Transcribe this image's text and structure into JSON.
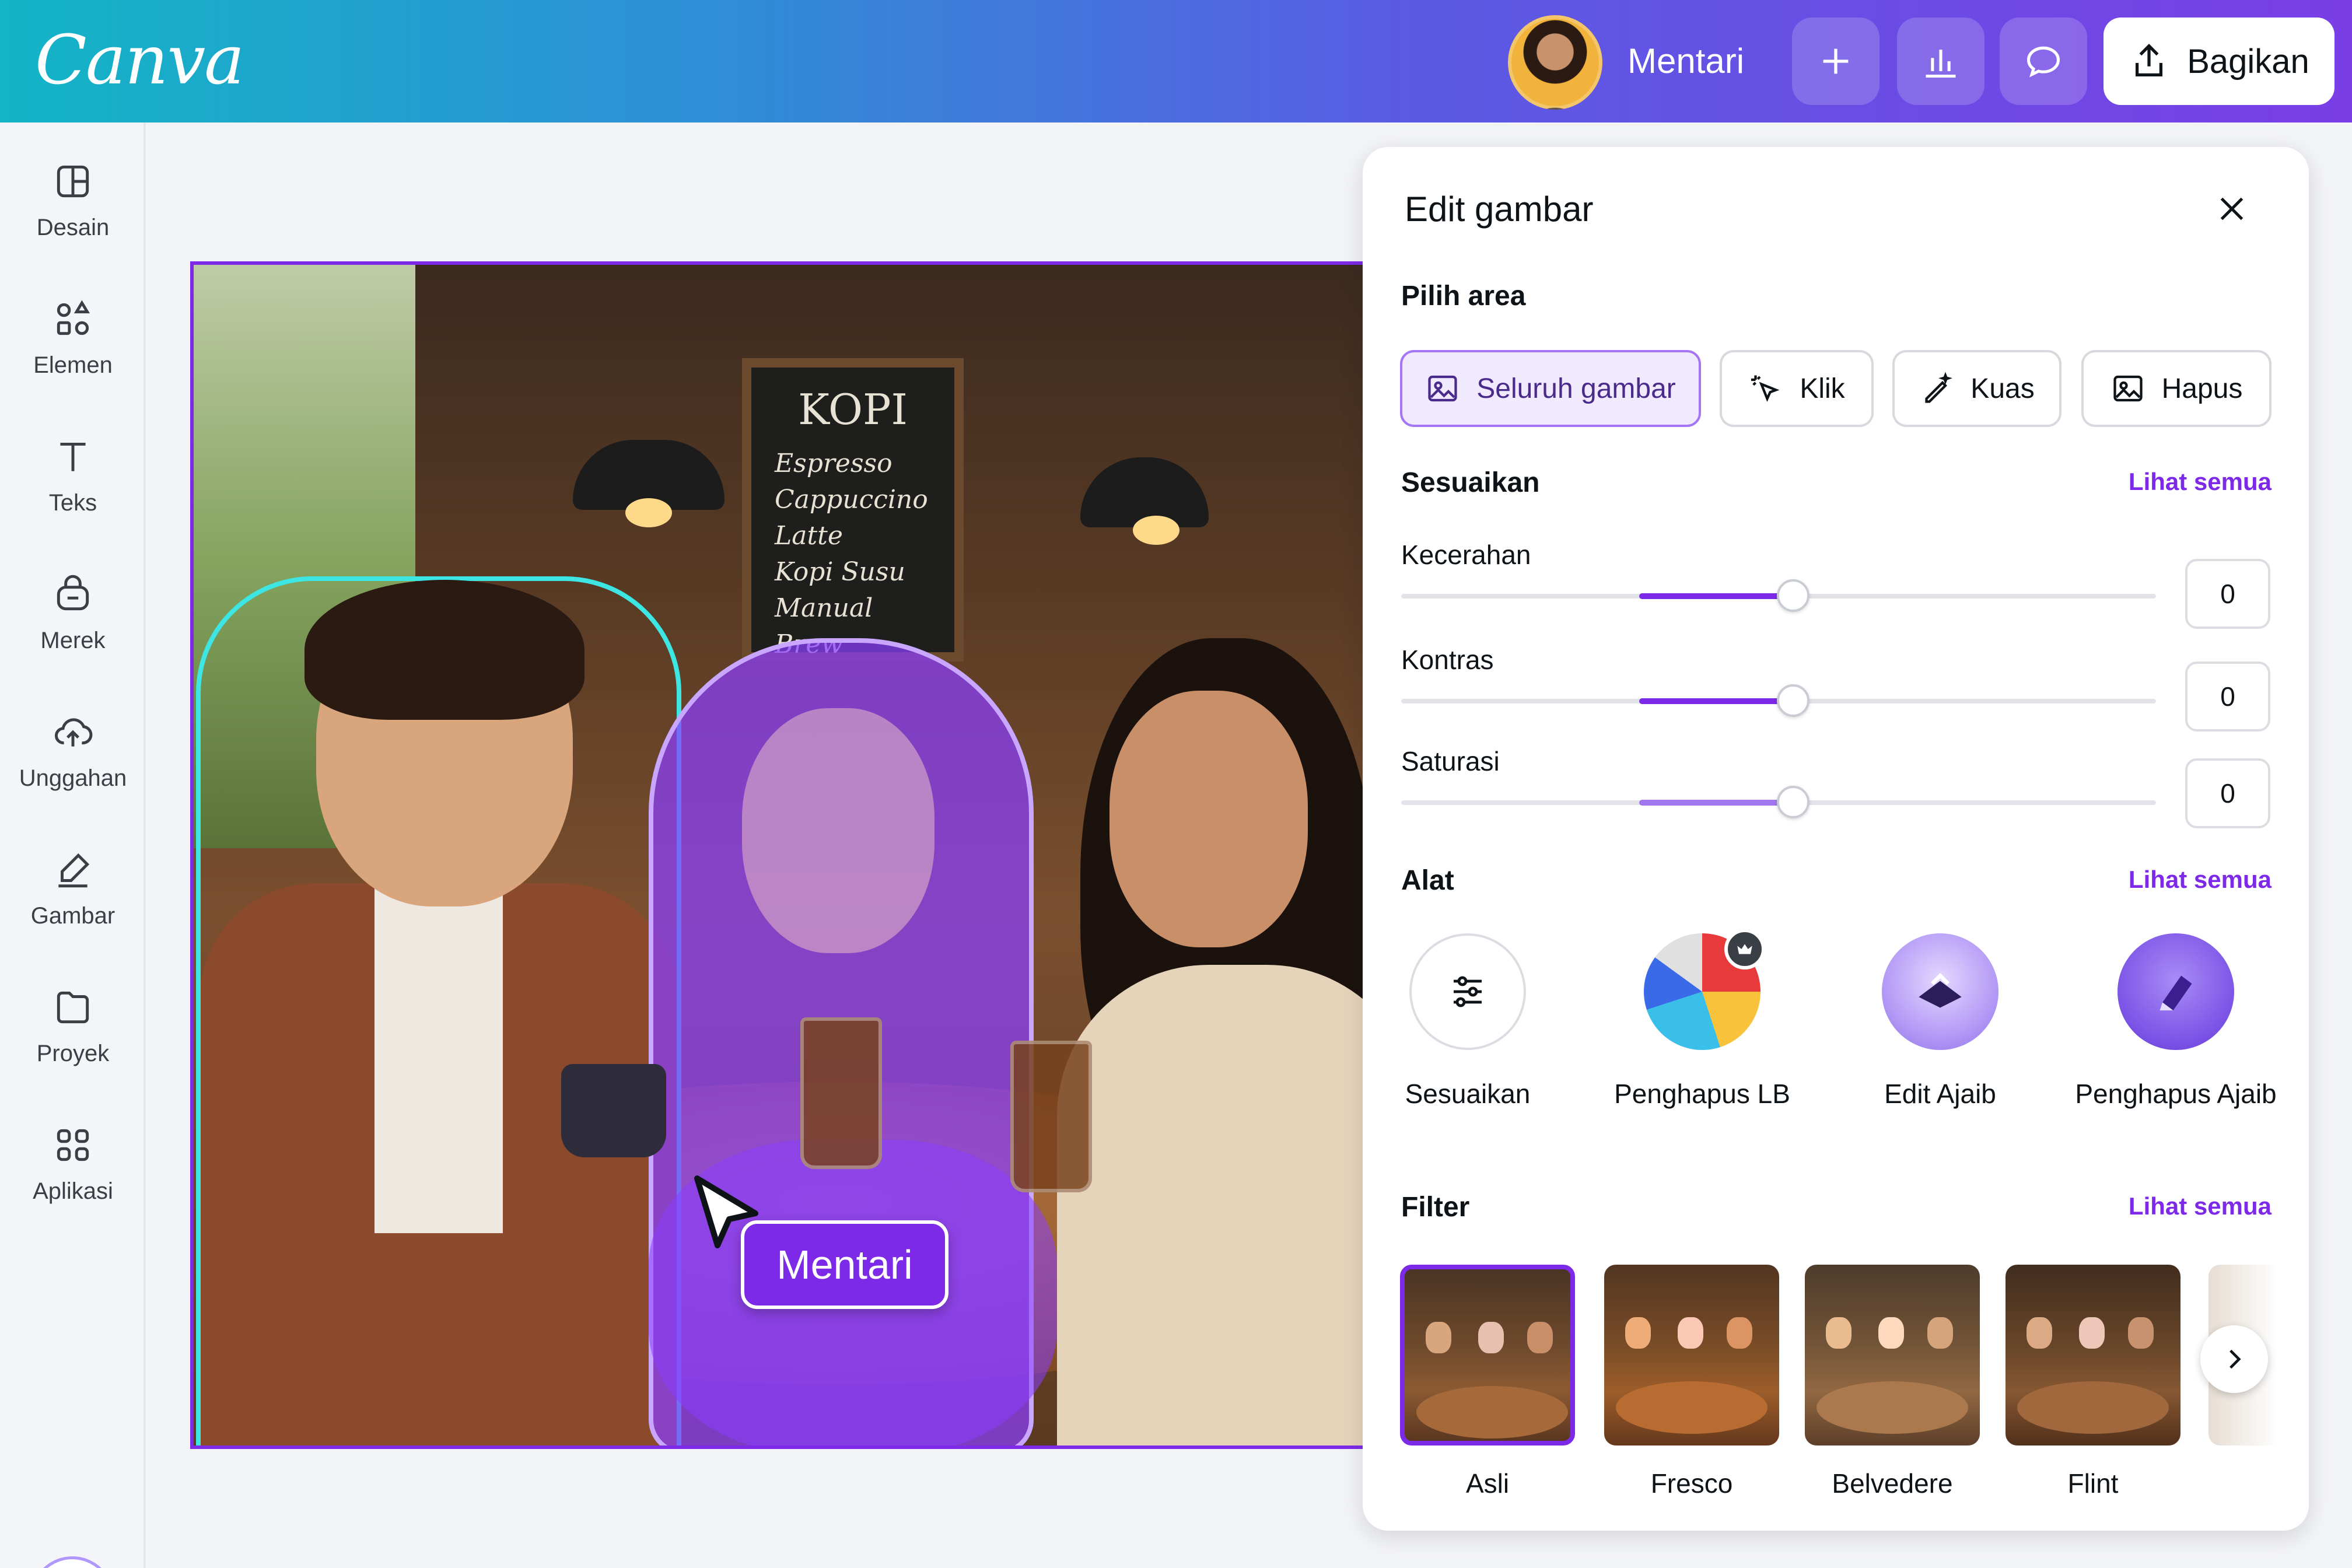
{
  "app": {
    "logo": "Canva",
    "user_name": "Mentari",
    "share_label": "Bagikan"
  },
  "sidebar": {
    "items": [
      {
        "label": "Desain",
        "icon": "layout-icon"
      },
      {
        "label": "Elemen",
        "icon": "shapes-icon"
      },
      {
        "label": "Teks",
        "icon": "text-icon"
      },
      {
        "label": "Merek",
        "icon": "brand-icon"
      },
      {
        "label": "Unggahan",
        "icon": "upload-cloud-icon"
      },
      {
        "label": "Gambar",
        "icon": "draw-icon"
      },
      {
        "label": "Proyek",
        "icon": "folder-icon"
      },
      {
        "label": "Aplikasi",
        "icon": "apps-grid-icon"
      }
    ]
  },
  "canvas": {
    "blackboard": {
      "title": "KOPI",
      "items": [
        "Espresso",
        "Cappuccino",
        "Latte",
        "Kopi Susu",
        "Manual Brew"
      ]
    },
    "cursor_label": "Mentari"
  },
  "panel": {
    "title": "Edit gambar",
    "select_area": {
      "title": "Pilih area",
      "options": [
        "Seluruh gambar",
        "Klik",
        "Kuas",
        "Hapus"
      ],
      "selected": "Seluruh gambar"
    },
    "adjust": {
      "title": "Sesuaikan",
      "see_all": "Lihat semua",
      "sliders": [
        {
          "label": "Kecerahan",
          "value": "0"
        },
        {
          "label": "Kontras",
          "value": "0"
        },
        {
          "label": "Saturasi",
          "value": "0"
        }
      ]
    },
    "tools": {
      "title": "Alat",
      "see_all": "Lihat semua",
      "items": [
        "Sesuaikan",
        "Penghapus LB",
        "Edit Ajaib",
        "Penghapus Ajaib"
      ]
    },
    "filters": {
      "title": "Filter",
      "see_all": "Lihat semua",
      "items": [
        "Asli",
        "Fresco",
        "Belvedere",
        "Flint"
      ],
      "selected": "Asli"
    }
  },
  "colors": {
    "accent": "#7d2ae8",
    "selection_outline": "#3de6e2"
  }
}
